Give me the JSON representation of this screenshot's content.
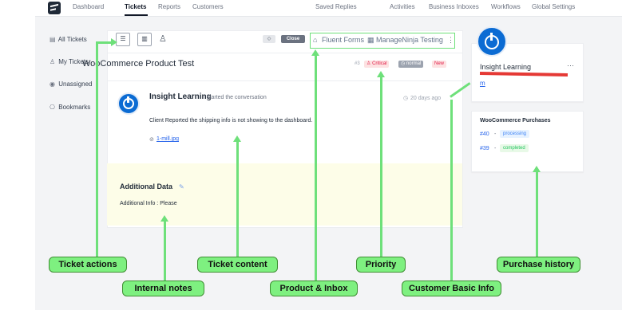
{
  "nav": {
    "links": [
      "Dashboard",
      "Tickets",
      "Reports",
      "Customers"
    ],
    "right_links": [
      "Saved Replies",
      "Activities",
      "Business Inboxes",
      "Workflows",
      "Global Settings"
    ]
  },
  "sidebar": {
    "items": [
      {
        "label": "All Tickets",
        "icon": "list-icon"
      },
      {
        "label": "My Tickets",
        "icon": "user-icon"
      },
      {
        "label": "Unassigned",
        "icon": "eye-icon"
      },
      {
        "label": "Bookmarks",
        "icon": "bookmark-icon"
      }
    ]
  },
  "ticket": {
    "title": "WooCommerce Product Test",
    "number": "#3",
    "priority": "Critical",
    "status_normal": "normal",
    "state": "New",
    "close_label": "Close",
    "product_label": "Fluent Forms",
    "inbox_label": "ManageNinja Testing",
    "author": "Insight Learning",
    "started_text": "started the conversation",
    "time_ago": "20 days ago",
    "message": "Client Reported the shipping info is not showing to the dashboard.",
    "attachment": "1-mill.jpg",
    "additional_title": "Additional Data",
    "additional_info": "Additional Info : Please"
  },
  "customer": {
    "name": "Insight Learning",
    "more": "···",
    "link_icon": "m"
  },
  "purchases": {
    "title": "WooCommerce Purchases",
    "items": [
      {
        "id": "#40",
        "status": "processing"
      },
      {
        "id": "#39",
        "status": "completed"
      }
    ]
  },
  "callouts": {
    "ticket_actions": "Ticket actions",
    "internal_notes": "Internal notes",
    "ticket_content": "Ticket content",
    "product_inbox": "Product & Inbox",
    "priority": "Priority",
    "customer_basic": "Customer Basic Info",
    "purchase_history": "Purchase history"
  },
  "colors": {
    "callout_green": "#7ef080",
    "critical_bg": "#fde2e2",
    "new_bg": "#fde2e2",
    "normal_bg": "#9ca3af",
    "processing_bg": "#e7f2ff",
    "completed_bg": "#e8f9e7"
  }
}
